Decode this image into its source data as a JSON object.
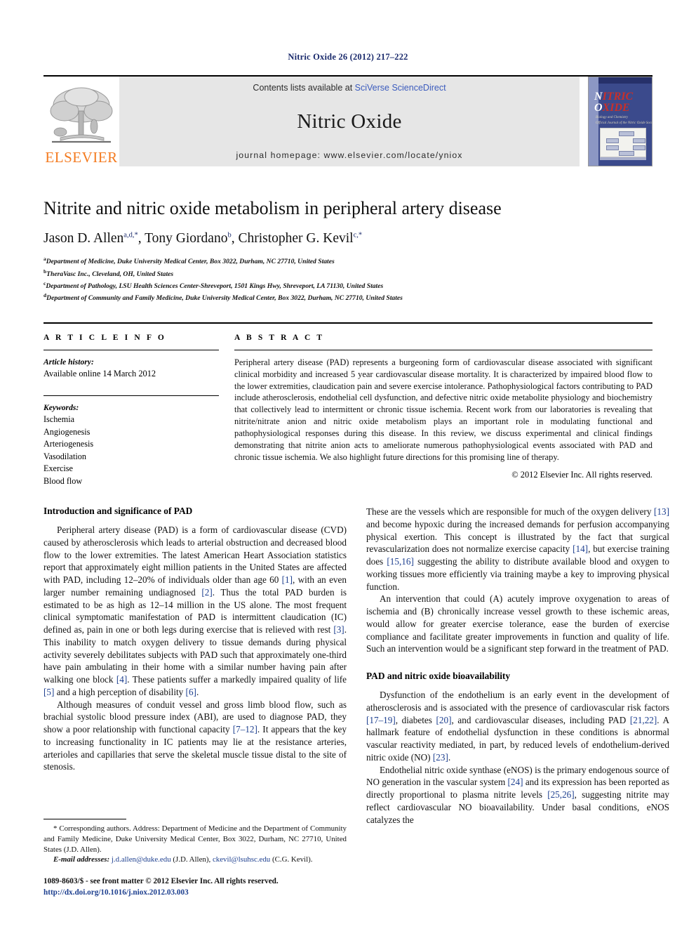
{
  "running_head": "Nitric Oxide 26 (2012) 217–222",
  "masthead": {
    "publisher_logo_text": "ELSEVIER",
    "contents_prefix": "Contents lists available at ",
    "contents_link": "SciVerse ScienceDirect",
    "journal_name": "Nitric Oxide",
    "homepage": "journal homepage: www.elsevier.com/locate/yniox",
    "cover": {
      "line1_cap": "N",
      "line1_rest": "ITRIC",
      "line2_cap": "O",
      "line2_rest": "XIDE",
      "subtitle1": "Biology and Chemistry",
      "subtitle2": "Official Journal of the Nitric Oxide Society"
    }
  },
  "article": {
    "title": "Nitrite and nitric oxide metabolism in peripheral artery disease",
    "authors": [
      {
        "name": "Jason D. Allen",
        "marks": "a,d,*"
      },
      {
        "name": "Tony Giordano",
        "marks": "b"
      },
      {
        "name": "Christopher G. Kevil",
        "marks": "c,*"
      }
    ],
    "affiliations": [
      {
        "mark": "a",
        "text": "Department of Medicine, Duke University Medical Center, Box 3022, Durham, NC 27710, United States"
      },
      {
        "mark": "b",
        "text": "TheraVasc Inc., Cleveland, OH, United States"
      },
      {
        "mark": "c",
        "text": "Department of Pathology, LSU Health Sciences Center-Shreveport, 1501 Kings Hwy, Shreveport, LA 71130, United States"
      },
      {
        "mark": "d",
        "text": "Department of Community and Family Medicine, Duke University Medical Center, Box 3022, Durham, NC 27710, United States"
      }
    ]
  },
  "article_info": {
    "heading": "A R T I C L E    I N F O",
    "history_label": "Article history:",
    "history_value": "Available online 14 March 2012",
    "keywords_label": "Keywords:",
    "keywords": [
      "Ischemia",
      "Angiogenesis",
      "Arteriogenesis",
      "Vasodilation",
      "Exercise",
      "Blood flow"
    ]
  },
  "abstract": {
    "heading": "A B S T R A C T",
    "text": "Peripheral artery disease (PAD) represents a burgeoning form of cardiovascular disease associated with significant clinical morbidity and increased 5 year cardiovascular disease mortality. It is characterized by impaired blood flow to the lower extremities, claudication pain and severe exercise intolerance. Pathophysiological factors contributing to PAD include atherosclerosis, endothelial cell dysfunction, and defective nitric oxide metabolite physiology and biochemistry that collectively lead to intermittent or chronic tissue ischemia. Recent work from our laboratories is revealing that nitrite/nitrate anion and nitric oxide metabolism plays an important role in modulating functional and pathophysiological responses during this disease. In this review, we discuss experimental and clinical findings demonstrating that nitrite anion acts to ameliorate numerous pathophysiological events associated with PAD and chronic tissue ischemia. We also highlight future directions for this promising line of therapy.",
    "copyright": "© 2012 Elsevier Inc. All rights reserved."
  },
  "body": {
    "left": {
      "section_heading": "Introduction and significance of PAD",
      "para1_a": "Peripheral artery disease (PAD) is a form of cardiovascular disease (CVD) caused by atherosclerosis which leads to arterial obstruction and decreased blood flow to the lower extremities. The latest American Heart Association statistics report that approximately eight million patients in the United States are affected with PAD, including 12–20% of individuals older than age 60 ",
      "para1_r1": "[1]",
      "para1_b": ", with an even larger number remaining undiagnosed ",
      "para1_r2": "[2]",
      "para1_c": ". Thus the total PAD burden is estimated to be as high as 12–14 million in the US alone. The most frequent clinical symptomatic manifestation of PAD is intermittent claudication (IC) defined as, pain in one or both legs during exercise that is relieved with rest ",
      "para1_r3": "[3]",
      "para1_d": ". This inability to match oxygen delivery to tissue demands during physical activity severely debilitates subjects with PAD such that approximately one-third have pain ambulating in their home with a similar number having pain after walking one block ",
      "para1_r4": "[4]",
      "para1_e": ". These patients suffer a markedly impaired quality of life ",
      "para1_r5": "[5]",
      "para1_f": " and a high perception of disability ",
      "para1_r6": "[6]",
      "para1_g": ".",
      "para2_a": "Although measures of conduit vessel and gross limb blood flow, such as brachial systolic blood pressure index (ABI), are used to diagnose PAD, they show a poor relationship with functional capacity ",
      "para2_r1": "[7–12]",
      "para2_b": ". It appears that the key to increasing functionality in IC patients may lie at the resistance arteries, arterioles and capillaries that serve the skeletal muscle tissue distal to the site of stenosis."
    },
    "right": {
      "para1_a": "These are the vessels which are responsible for much of the oxygen delivery ",
      "para1_r1": "[13]",
      "para1_b": " and become hypoxic during the increased demands for perfusion accompanying physical exertion. This concept is illustrated by the fact that surgical revascularization does not normalize exercise capacity ",
      "para1_r2": "[14]",
      "para1_c": ", but exercise training does ",
      "para1_r3": "[15,16]",
      "para1_d": " suggesting the ability to distribute available blood and oxygen to working tissues more efficiently via training maybe a key to improving physical function.",
      "para2": "An intervention that could (A) acutely improve oxygenation to areas of ischemia and (B) chronically increase vessel growth to these ischemic areas, would allow for greater exercise tolerance, ease the burden of exercise compliance and facilitate greater improvements in function and quality of life. Such an intervention would be a significant step forward in the treatment of PAD.",
      "section_heading": "PAD and nitric oxide bioavailability",
      "para3_a": "Dysfunction of the endothelium is an early event in the development of atherosclerosis and is associated with the presence of cardiovascular risk factors ",
      "para3_r1": "[17–19]",
      "para3_b": ", diabetes ",
      "para3_r2": "[20]",
      "para3_c": ", and cardiovascular diseases, including PAD ",
      "para3_r3": "[21,22]",
      "para3_d": ". A hallmark feature of endothelial dysfunction in these conditions is abnormal vascular reactivity mediated, in part, by reduced levels of endothelium-derived nitric oxide (NO) ",
      "para3_r4": "[23]",
      "para3_e": ".",
      "para4_a": "Endothelial nitric oxide synthase (eNOS) is the primary endogenous source of NO generation in the vascular system ",
      "para4_r1": "[24]",
      "para4_b": " and its expression has been reported as directly proportional to plasma nitrite levels ",
      "para4_r2": "[25,26]",
      "para4_c": ", suggesting nitrite may reflect cardiovascular NO bioavailability. Under basal conditions, eNOS catalyzes the"
    }
  },
  "footnotes": {
    "corresponding": "* Corresponding authors. Address: Department of Medicine and the Department of Community and Family Medicine, Duke University Medical Center, Box 3022, Durham, NC 27710, United States (J.D. Allen).",
    "email_label": "E-mail addresses:",
    "email1": "j.d.allen@duke.edu",
    "email1_who": " (J.D. Allen), ",
    "email2": "ckevil@lsuhsc.edu",
    "email2_who": " (C.G. Kevil).",
    "imprint": "1089-8603/$ - see front matter © 2012 Elsevier Inc. All rights reserved.",
    "doi": "http://dx.doi.org/10.1016/j.niox.2012.03.003"
  }
}
